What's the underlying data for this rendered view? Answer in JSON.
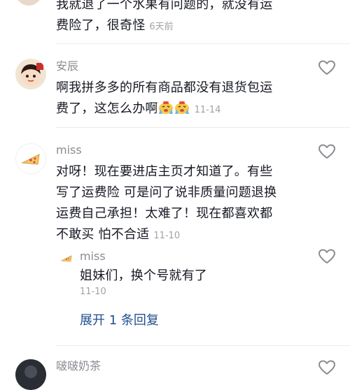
{
  "comments": [
    {
      "lines": [
        "我就退了一个水果有问题的，就没有运",
        "费险了，很奇怪"
      ],
      "time": "6天前"
    },
    {
      "username": "安辰",
      "lines": [
        "啊我拼多多的所有商品都没有退货包运",
        "费了，这怎么办啊"
      ],
      "emoji": [
        "crying-face",
        "crying-face"
      ],
      "time": "11-14"
    },
    {
      "username": "miss",
      "lines": [
        "对呀！现在要进店主页才知道了。有些",
        "写了运费险 可是问了说非质量问题退换",
        "运费自己承担！太难了！现在都喜欢都",
        "不敢买 怕不合适"
      ],
      "time": "11-10",
      "reply": {
        "username": "miss",
        "text": "姐妹们，换个号就有了",
        "time": "11-10"
      },
      "expand_label": "展开 1 条回复"
    },
    {
      "username": "啵啵奶茶"
    }
  ],
  "colors": {
    "username": "#8a8b91",
    "time": "#a1a2a7",
    "expand": "#1e4f8f",
    "divider": "#ececec"
  }
}
